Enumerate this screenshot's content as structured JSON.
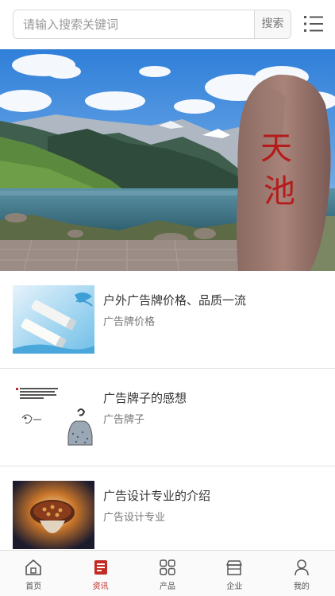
{
  "search": {
    "placeholder": "请输入搜索关键词",
    "button_label": "搜索"
  },
  "banner": {
    "stone_text": "天池",
    "slide_count": 1,
    "active_slide": 1
  },
  "news": [
    {
      "title": "户外广告牌价格、品质一流",
      "subtitle": "广告牌价格"
    },
    {
      "title": "广告牌子的感想",
      "subtitle": "广告牌子"
    },
    {
      "title": "广告设计专业的介绍",
      "subtitle": "广告设计专业"
    }
  ],
  "nav": [
    {
      "label": "首页",
      "icon": "home-icon",
      "active": false
    },
    {
      "label": "资讯",
      "icon": "news-icon",
      "active": true
    },
    {
      "label": "产品",
      "icon": "grid-icon",
      "active": false
    },
    {
      "label": "企业",
      "icon": "store-icon",
      "active": false
    },
    {
      "label": "我的",
      "icon": "user-icon",
      "active": false
    }
  ],
  "colors": {
    "accent": "#c22a24",
    "border": "#d9d9d9"
  }
}
